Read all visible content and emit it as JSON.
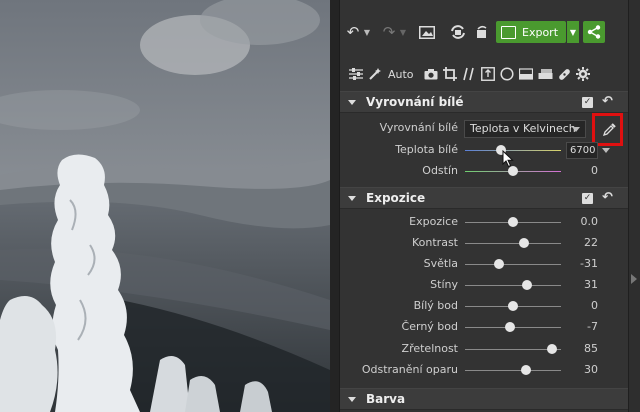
{
  "toolbar": {
    "export_label": "Export",
    "colors": {
      "accent_green": "#4a9a2f"
    },
    "icons": [
      "undo-icon",
      "redo-icon",
      "image-icon",
      "rotate-icon",
      "export-icon",
      "share-icon"
    ]
  },
  "tools": {
    "auto_label": "Auto",
    "icons": [
      "sliders-icon",
      "magic-wand-icon",
      "camera-icon",
      "crop-icon",
      "straighten-icon",
      "text-box-icon",
      "circle-icon",
      "gradient-icon",
      "eraser-icon",
      "bandage-icon",
      "gear-icon"
    ]
  },
  "white_balance": {
    "title": "Vyrovnání bílé",
    "mode_label": "Vyrovnání bílé",
    "mode_value": "Teplota v Kelvinech",
    "temp_label": "Teplota bílé",
    "temp_value": "6700",
    "temp_level": 0.38,
    "tint_label": "Odstín",
    "tint_value": "0",
    "tint_level": 0.5
  },
  "exposure": {
    "title": "Expozice",
    "rows": [
      {
        "label": "Expozice",
        "value": "0.0",
        "level": 0.5
      },
      {
        "label": "Kontrast",
        "value": "22",
        "level": 0.61
      },
      {
        "label": "Světla",
        "value": "-31",
        "level": 0.35
      },
      {
        "label": "Stíny",
        "value": "31",
        "level": 0.65
      },
      {
        "label": "Bílý bod",
        "value": "0",
        "level": 0.5
      },
      {
        "label": "Černý bod",
        "value": "-7",
        "level": 0.47
      },
      {
        "label": "Zřetelnost",
        "value": "85",
        "level": 0.91
      },
      {
        "label": "Odstranění oparu",
        "value": "30",
        "level": 0.64
      }
    ]
  },
  "color_section": {
    "title": "Barva"
  }
}
